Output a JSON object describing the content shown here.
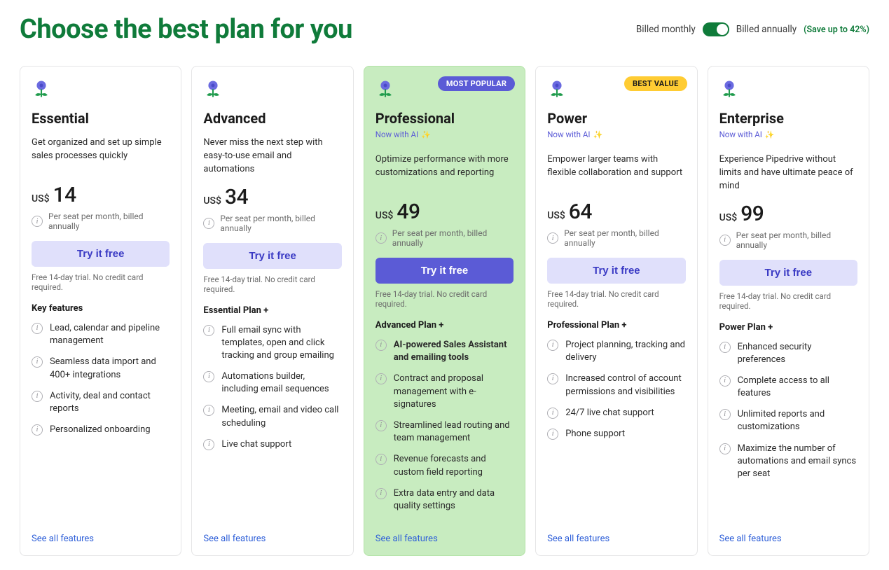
{
  "header": {
    "title": "Choose the best plan for you",
    "billed_monthly": "Billed monthly",
    "billed_annually": "Billed annually",
    "save_note": "(Save up to 42%)"
  },
  "common": {
    "currency": "US$",
    "price_note": "Per seat per month, billed annually",
    "trial_note": "Free 14-day trial. No credit card required.",
    "cta_label": "Try it free",
    "see_all": "See all features",
    "ai_tag": "Now with AI"
  },
  "plans": [
    {
      "id": "essential",
      "name": "Essential",
      "desc": "Get organized and set up simple sales processes quickly",
      "price": "14",
      "features_heading": "Key features",
      "features": [
        {
          "text": "Lead, calendar and pipeline management"
        },
        {
          "text": "Seamless data import and 400+ integrations"
        },
        {
          "text": "Activity, deal and contact reports"
        },
        {
          "text": "Personalized onboarding"
        }
      ]
    },
    {
      "id": "advanced",
      "name": "Advanced",
      "desc": "Never miss the next step with easy-to-use email and automations",
      "price": "34",
      "features_heading": "Essential Plan +",
      "features": [
        {
          "text": "Full email sync with templates, open and click tracking and group emailing"
        },
        {
          "text": "Automations builder, including email sequences"
        },
        {
          "text": "Meeting, email and video call scheduling"
        },
        {
          "text": "Live chat support"
        }
      ]
    },
    {
      "id": "professional",
      "name": "Professional",
      "desc": "Optimize performance with more customizations and reporting",
      "price": "49",
      "badge": "MOST POPULAR",
      "ai": true,
      "featured": true,
      "features_heading": "Advanced Plan +",
      "features": [
        {
          "text": "AI-powered Sales Assistant and emailing tools",
          "bold": true
        },
        {
          "text": "Contract and proposal management with e-signatures"
        },
        {
          "text": "Streamlined lead routing and team management"
        },
        {
          "text": "Revenue forecasts and custom field reporting"
        },
        {
          "text": "Extra data entry and data quality settings"
        }
      ]
    },
    {
      "id": "power",
      "name": "Power",
      "desc": "Empower larger teams with flexible collaboration and support",
      "price": "64",
      "badge": "BEST VALUE",
      "ai": true,
      "features_heading": "Professional Plan +",
      "features": [
        {
          "text": "Project planning, tracking and delivery"
        },
        {
          "text": "Increased control of account permissions and visibilities"
        },
        {
          "text": "24/7 live chat support"
        },
        {
          "text": "Phone support"
        }
      ]
    },
    {
      "id": "enterprise",
      "name": "Enterprise",
      "desc": "Experience Pipedrive without limits and have ultimate peace of mind",
      "price": "99",
      "ai": true,
      "features_heading": "Power Plan +",
      "features": [
        {
          "text": "Enhanced security preferences"
        },
        {
          "text": "Complete access to all features"
        },
        {
          "text": "Unlimited reports and customizations"
        },
        {
          "text": "Maximize the number of automations and email syncs per seat"
        }
      ]
    }
  ]
}
